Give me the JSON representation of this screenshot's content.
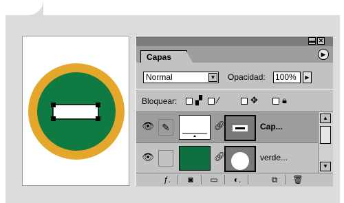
{
  "canvas": {
    "colors": {
      "ring": "#e4a72b",
      "fill": "#0f7a42",
      "bar": "#ffffff",
      "handles": "#000000"
    }
  },
  "panel": {
    "titlebar": {
      "minimize": "▬",
      "close": "✕"
    },
    "tab_label": "Capas",
    "menu_icon": "▶",
    "blend_mode": "Normal",
    "opacity_label": "Opacidad:",
    "opacity_value": "100%",
    "lock_label": "Bloquear:",
    "lock_icons": [
      "lock-transparent-icon",
      "brush-lock-icon",
      "move-lock-icon",
      "lock-all-icon"
    ],
    "layers": [
      {
        "name": "Cap...",
        "selected": true,
        "thumb_color": "#ffffff",
        "mask": "rect"
      },
      {
        "name": "verde...",
        "selected": false,
        "thumb_color": "#0f6e3d",
        "mask": "circle"
      }
    ],
    "bottom_icons": [
      "layer-style-icon",
      "mask-icon",
      "folder-icon",
      "adjustment-icon",
      "new-layer-icon",
      "trash-icon"
    ]
  }
}
